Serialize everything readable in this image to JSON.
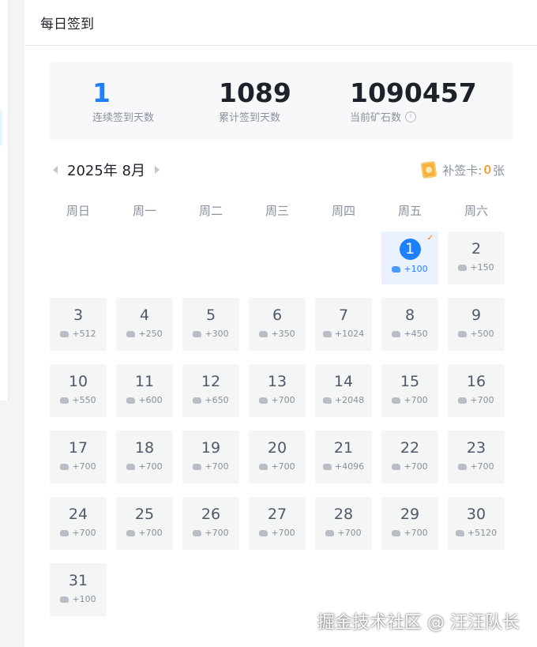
{
  "header": {
    "title": "每日签到"
  },
  "stats": {
    "streak_value": "1",
    "streak_label": "连续签到天数",
    "total_value": "1089",
    "total_label": "累计签到天数",
    "ore_value": "1090457",
    "ore_label": "当前矿石数"
  },
  "calendar": {
    "month_label": "2025年 8月",
    "makeup_label": "补签卡:",
    "makeup_count": "0",
    "makeup_unit": "张",
    "weekdays": [
      "周日",
      "周一",
      "周二",
      "周三",
      "周四",
      "周五",
      "周六"
    ],
    "first_weekday_index": 5,
    "signed_day": 1,
    "days": [
      {
        "day": "1",
        "reward": "+100"
      },
      {
        "day": "2",
        "reward": "+150"
      },
      {
        "day": "3",
        "reward": "+512"
      },
      {
        "day": "4",
        "reward": "+250"
      },
      {
        "day": "5",
        "reward": "+300"
      },
      {
        "day": "6",
        "reward": "+350"
      },
      {
        "day": "7",
        "reward": "+1024"
      },
      {
        "day": "8",
        "reward": "+450"
      },
      {
        "day": "9",
        "reward": "+500"
      },
      {
        "day": "10",
        "reward": "+550"
      },
      {
        "day": "11",
        "reward": "+600"
      },
      {
        "day": "12",
        "reward": "+650"
      },
      {
        "day": "13",
        "reward": "+700"
      },
      {
        "day": "14",
        "reward": "+2048"
      },
      {
        "day": "15",
        "reward": "+700"
      },
      {
        "day": "16",
        "reward": "+700"
      },
      {
        "day": "17",
        "reward": "+700"
      },
      {
        "day": "18",
        "reward": "+700"
      },
      {
        "day": "19",
        "reward": "+700"
      },
      {
        "day": "20",
        "reward": "+700"
      },
      {
        "day": "21",
        "reward": "+4096"
      },
      {
        "day": "22",
        "reward": "+700"
      },
      {
        "day": "23",
        "reward": "+700"
      },
      {
        "day": "24",
        "reward": "+700"
      },
      {
        "day": "25",
        "reward": "+700"
      },
      {
        "day": "26",
        "reward": "+700"
      },
      {
        "day": "27",
        "reward": "+700"
      },
      {
        "day": "28",
        "reward": "+700"
      },
      {
        "day": "29",
        "reward": "+700"
      },
      {
        "day": "30",
        "reward": "+5120"
      },
      {
        "day": "31",
        "reward": "+100"
      }
    ]
  },
  "watermark": {
    "text": "掘金技术社区 @ 汪汪队长"
  },
  "icons": {
    "ore": "ore-icon",
    "makeup_card": "makeup-card-icon",
    "info": "info-icon",
    "check": "check-icon"
  },
  "colors": {
    "accent": "#1e80ff",
    "makeup_count": "#ff7d00",
    "signed_bg": "#eaf2ff"
  }
}
